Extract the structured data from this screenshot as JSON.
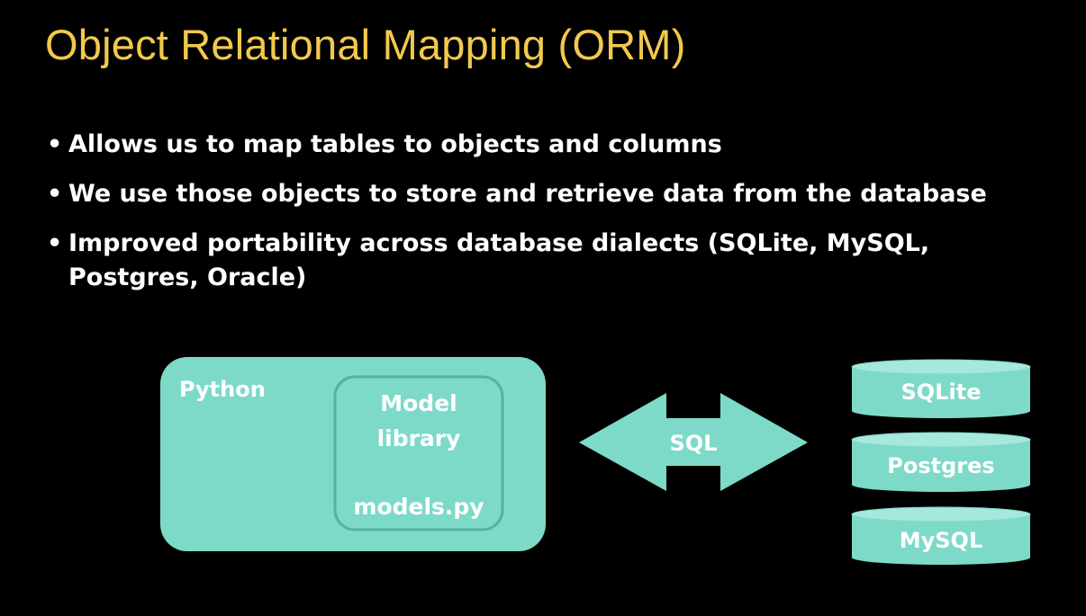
{
  "slide": {
    "title": "Object Relational Mapping (ORM)",
    "bullets": [
      "Allows us to map tables to objects and columns",
      "We use those objects to store and retrieve data from the database",
      "Improved portability across database dialects (SQLite, MySQL, Postgres, Oracle)"
    ],
    "bullet_glyph": "•",
    "colors": {
      "title": "#f2c94c",
      "text": "#ffffff",
      "shape_fill": "#7ddac8",
      "background": "#000000"
    }
  },
  "diagram": {
    "python_label": "Python",
    "model_library_line1": "Model",
    "model_library_line2": "library",
    "models_file": "models.py",
    "arrow_label": "SQL",
    "databases": [
      "SQLite",
      "Postgres",
      "MySQL"
    ]
  }
}
